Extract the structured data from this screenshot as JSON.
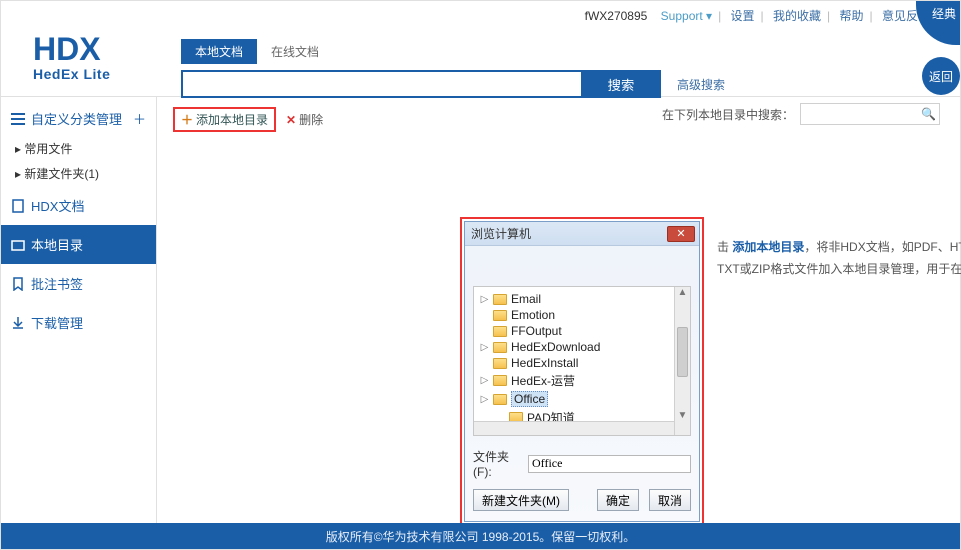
{
  "header": {
    "user_code": "fWX270895",
    "links": [
      "Support",
      "设置",
      "我的收藏",
      "帮助",
      "意见反馈"
    ],
    "corner": {
      "classic": "经典",
      "back": "返回"
    },
    "logo": {
      "big": "HDX",
      "sub": "HedEx Lite"
    },
    "tabs": [
      "本地文档",
      "在线文档"
    ],
    "search": {
      "placeholder": "",
      "button": "搜索",
      "advanced": "高级搜索"
    }
  },
  "sidebar": {
    "custom": {
      "title": "自定义分类管理",
      "items": [
        "常用文件",
        "新建文件夹(1)"
      ]
    },
    "sections": [
      "HDX文档",
      "本地目录",
      "批注书签",
      "下载管理"
    ]
  },
  "toolbar": {
    "add": "添加本地目录",
    "delete": "删除",
    "filter_label": "在下列本地目录中搜索："
  },
  "hint": {
    "p1": "击",
    "link": "添加本地目录",
    "p2": "，将非HDX文档，如PDF、HTML、",
    "p3": "TXT或ZIP格式文件加入本地目录管理，用于在HedEx"
  },
  "dialog": {
    "title": "浏览计算机",
    "tree": [
      "Email",
      "Emotion",
      "FFOutput",
      "HedExDownload",
      "HedExInstall",
      "HedEx-运营",
      "Office",
      "PAD知道"
    ],
    "folder_label": "文件夹(F):",
    "folder_value": "Office",
    "buttons": {
      "newfolder": "新建文件夹(M)",
      "ok": "确定",
      "cancel": "取消"
    }
  },
  "footer": {
    "text": "版权所有©华为技术有限公司 1998-2015。保留一切权利。"
  }
}
